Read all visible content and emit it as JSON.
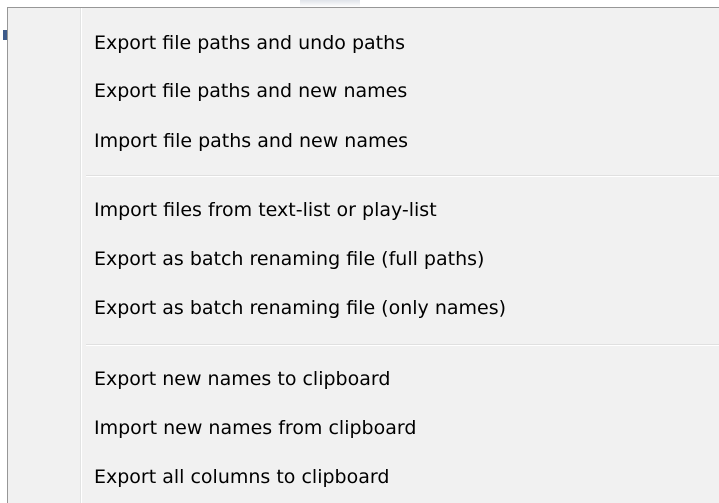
{
  "menu": {
    "groups": [
      {
        "items": [
          {
            "label": "Export file paths and undo paths"
          },
          {
            "label": "Export file paths and new names"
          },
          {
            "label": "Import file paths and new names"
          }
        ]
      },
      {
        "items": [
          {
            "label": "Import files from text-list or play-list"
          },
          {
            "label": "Export as batch renaming file (full paths)"
          },
          {
            "label": "Export as batch renaming file (only names)"
          }
        ]
      },
      {
        "items": [
          {
            "label": "Export new names to clipboard"
          },
          {
            "label": "Import new names from clipboard"
          },
          {
            "label": "Export all columns to clipboard"
          }
        ]
      }
    ]
  }
}
